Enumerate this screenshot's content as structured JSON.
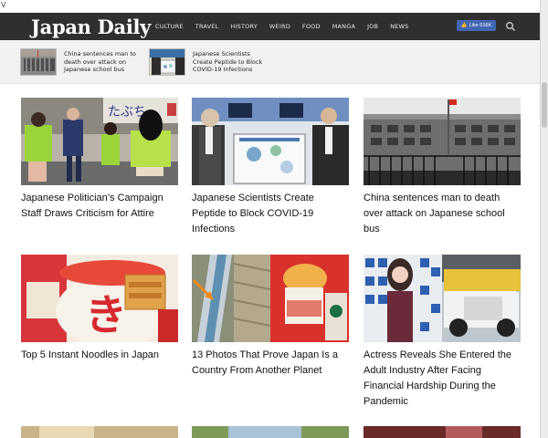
{
  "browser": {
    "corner_text": "V"
  },
  "site": {
    "logo": "Japan Daily",
    "nav": [
      "CULTURE",
      "TRAVEL",
      "HISTORY",
      "WEIRD",
      "FOOD",
      "MANGA",
      "JOB",
      "NEWS"
    ],
    "fb_like": "Like 616K",
    "search_icon": "search-icon"
  },
  "ticker": [
    {
      "title": "China sentences man to death over attack on Japanese school bus"
    },
    {
      "title": "Japanese Scientists Create Peptide to Block COVID-19 Infections"
    }
  ],
  "articles": [
    {
      "title": "Japanese Politician’s Campaign Staff Draws Criticism for Attire"
    },
    {
      "title": "Japanese Scientists Create Peptide to Block COVID-19 Infections"
    },
    {
      "title": "China sentences man to death over attack on Japanese school bus"
    },
    {
      "title": "Top 5 Instant Noodles in Japan"
    },
    {
      "title": "13 Photos That Prove Japan Is a Country From Another Planet"
    },
    {
      "title": "Actress Reveals She Entered the Adult Industry After Facing Financial Hardship During the Pandemic"
    }
  ],
  "colors": {
    "header": "#2f2f2f",
    "ticker_bg": "#f1f1f1",
    "fb_blue": "#4267b2"
  }
}
